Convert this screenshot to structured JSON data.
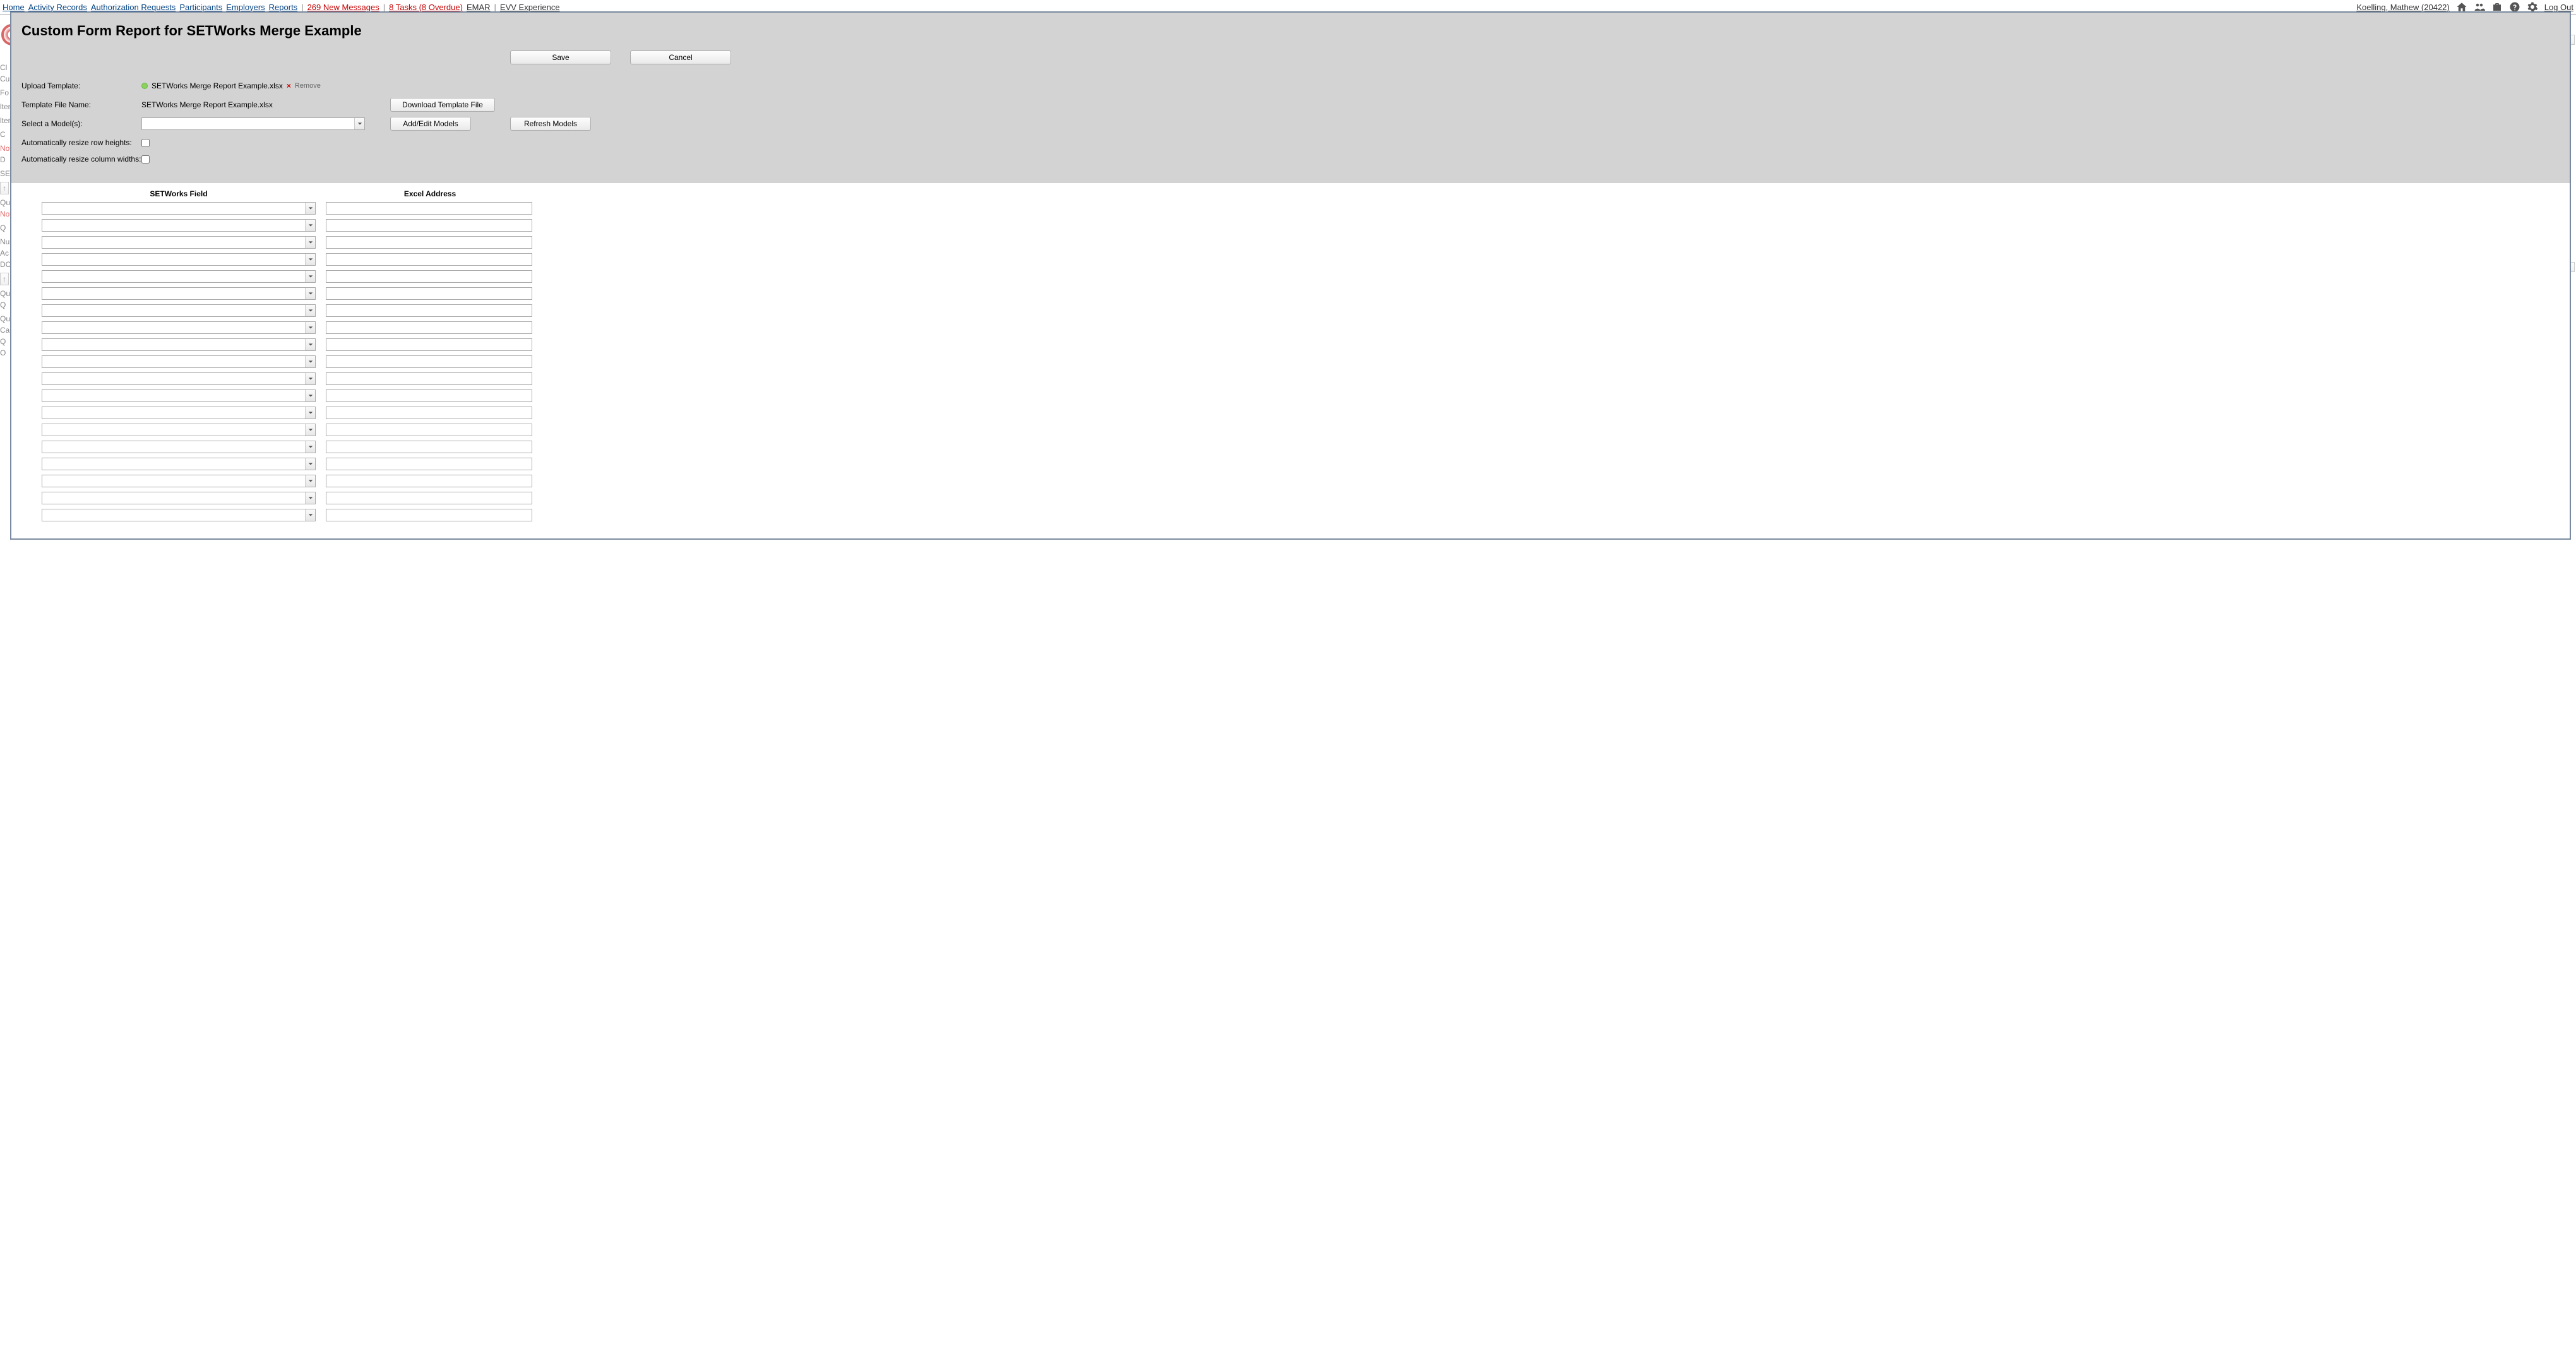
{
  "nav": {
    "items": [
      {
        "label": "Home"
      },
      {
        "label": "Activity Records"
      },
      {
        "label": "Authorization Requests"
      },
      {
        "label": "Participants"
      },
      {
        "label": "Employers"
      },
      {
        "label": "Reports"
      }
    ],
    "messages": "269 New Messages",
    "tasks": "8 Tasks (8 Overdue)",
    "emar": "EMAR",
    "evv": "EVV Experience",
    "user": "Koelling, Mathew  (20422)",
    "logout": "Log Out"
  },
  "modal": {
    "title": "Custom Form Report for SETWorks Merge Example",
    "save": "Save",
    "cancel": "Cancel",
    "labels": {
      "upload_template": "Upload Template:",
      "template_file_name": "Template File Name:",
      "select_model": "Select a Model(s):",
      "auto_row": "Automatically resize row heights:",
      "auto_col": "Automatically resize column widths:"
    },
    "file": {
      "name": "SETWorks Merge Report Example.xlsx",
      "remove": "Remove"
    },
    "template_file_value": "SETWorks Merge Report Example.xlsx",
    "buttons": {
      "download_template": "Download Template File",
      "add_edit_models": "Add/Edit Models",
      "refresh_models": "Refresh Models"
    },
    "columns": {
      "setworks_field": "SETWorks Field",
      "excel_address": "Excel Address"
    },
    "rows": [
      {
        "field": "",
        "address": ""
      },
      {
        "field": "",
        "address": ""
      },
      {
        "field": "",
        "address": ""
      },
      {
        "field": "",
        "address": ""
      },
      {
        "field": "",
        "address": ""
      },
      {
        "field": "",
        "address": ""
      },
      {
        "field": "",
        "address": ""
      },
      {
        "field": "",
        "address": ""
      },
      {
        "field": "",
        "address": ""
      },
      {
        "field": "",
        "address": ""
      },
      {
        "field": "",
        "address": ""
      },
      {
        "field": "",
        "address": ""
      },
      {
        "field": "",
        "address": ""
      },
      {
        "field": "",
        "address": ""
      },
      {
        "field": "",
        "address": ""
      },
      {
        "field": "",
        "address": ""
      },
      {
        "field": "",
        "address": ""
      },
      {
        "field": "",
        "address": ""
      },
      {
        "field": "",
        "address": ""
      }
    ]
  },
  "bg_left": [
    "Cl",
    "Cu",
    "",
    "Fo",
    "",
    "lter",
    "",
    "lter",
    "",
    "C",
    "",
    "Not",
    "D",
    "",
    "SE",
    "",
    "↑",
    "",
    "Que",
    "Not",
    "",
    "Q",
    "",
    "Nu",
    "Ac",
    "DO",
    "",
    "↑",
    "",
    "Que",
    "Q",
    "",
    "Que",
    "Car",
    "Q",
    "O"
  ]
}
